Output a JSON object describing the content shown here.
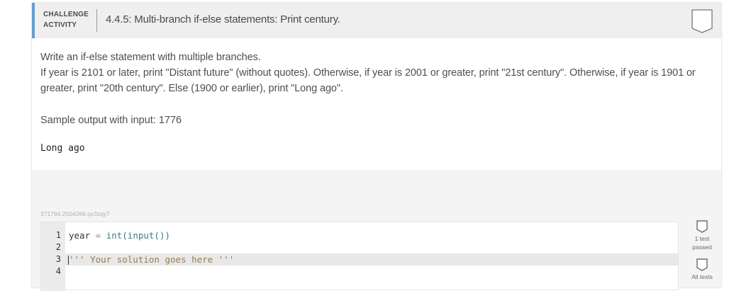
{
  "header": {
    "tag_line1": "CHALLENGE",
    "tag_line2": "ACTIVITY",
    "title": "4.4.5: Multi-branch if-else statements: Print century."
  },
  "description": {
    "line1": "Write an if-else statement with multiple branches.",
    "line2": "If year is 2101 or later, print \"Distant future\" (without quotes). Otherwise, if year is 2001 or greater, print \"21st century\". Otherwise, if year is 1901 or greater, print \"20th century\". Else (1900 or earlier), print \"Long ago\"."
  },
  "sample": {
    "label": "Sample output with input: 1776",
    "output": "Long ago"
  },
  "editor": {
    "code_id": "371764.2504266.qx3zqy7",
    "line_numbers": [
      "1",
      "2",
      "3",
      "4"
    ],
    "line1": {
      "var": "year",
      "op": " = ",
      "call": "int(input())"
    },
    "line3": {
      "comment": "''' Your solution goes here '''"
    }
  },
  "status": {
    "test_label_line1": "1 test",
    "test_label_line2": "passed",
    "all_tests_label": "All tests"
  },
  "colors": {
    "accent": "#5c9fd9",
    "header_bg": "#efefef"
  }
}
